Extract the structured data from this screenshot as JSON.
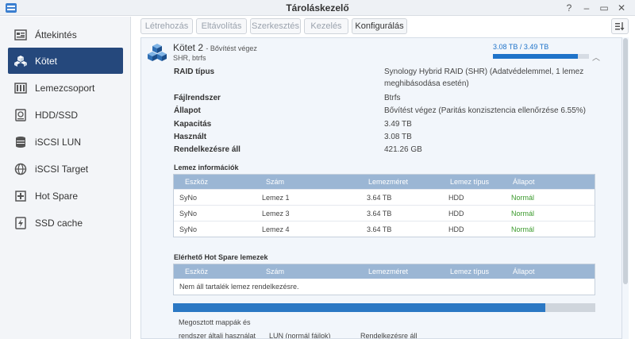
{
  "window": {
    "title": "Tároláskezelő",
    "controls": [
      "?",
      "–",
      "▭",
      "✕"
    ]
  },
  "sidebar": {
    "items": [
      {
        "label": "Áttekintés",
        "icon": "overview-icon",
        "active": false
      },
      {
        "label": "Kötet",
        "icon": "volume-icon",
        "active": true
      },
      {
        "label": "Lemezcsoport",
        "icon": "disk-group-icon",
        "active": false
      },
      {
        "label": "HDD/SSD",
        "icon": "hdd-icon",
        "active": false
      },
      {
        "label": "iSCSI LUN",
        "icon": "iscsi-lun-icon",
        "active": false
      },
      {
        "label": "iSCSI Target",
        "icon": "iscsi-target-icon",
        "active": false
      },
      {
        "label": "Hot Spare",
        "icon": "hot-spare-icon",
        "active": false
      },
      {
        "label": "SSD cache",
        "icon": "ssd-cache-icon",
        "active": false
      }
    ]
  },
  "toolbar": {
    "create": "Létrehozás",
    "remove": "Eltávolítás",
    "edit": "Szerkesztés",
    "manage": "Kezelés",
    "configure": "Konfigurálás"
  },
  "volume": {
    "name": "Kötet 2",
    "state": "Bővítést végez",
    "subtitle": "SHR, btrfs",
    "usage_text": "3.08 TB / 3.49 TB",
    "usage_fraction": 0.882,
    "properties": [
      {
        "label": "RAID típus",
        "value": "Synology Hybrid RAID (SHR) (Adatvédelemmel, 1 lemez meghibásodása esetén)"
      },
      {
        "label": "Fájlrendszer",
        "value": "Btrfs"
      },
      {
        "label": "Állapot",
        "value": "Bővítést végez (Paritás konzisztencia ellenőrzése 6.55%)"
      },
      {
        "label": "Kapacitás",
        "value": "3.49 TB"
      },
      {
        "label": "Használt",
        "value": "3.08 TB"
      },
      {
        "label": "Rendelkezésre áll",
        "value": "421.26 GB"
      }
    ]
  },
  "disk_info": {
    "title": "Lemez információk",
    "columns": [
      "Eszköz",
      "Szám",
      "Lemezméret",
      "Lemez típus",
      "Állapot"
    ],
    "rows": [
      [
        "SyNo",
        "Lemez 1",
        "3.64 TB",
        "HDD",
        "Normál"
      ],
      [
        "SyNo",
        "Lemez 3",
        "3.64 TB",
        "HDD",
        "Normál"
      ],
      [
        "SyNo",
        "Lemez 4",
        "3.64 TB",
        "HDD",
        "Normál"
      ]
    ]
  },
  "hot_spare": {
    "title": "Elérhető Hot Spare lemezek",
    "columns": [
      "Eszköz",
      "Szám",
      "Lemezméret",
      "Lemez típus",
      "Állapot"
    ],
    "empty_text": "Nem áll tartalék lemez rendelkezésre."
  },
  "usage_breakdown": {
    "fill_fraction": 0.882,
    "legend": {
      "shared_line1": "Megosztott mappák és",
      "shared_line2": "rendszer általi használat",
      "lun": "LUN (normál fájlok)",
      "available": "Rendelkezésre áll"
    }
  },
  "colors": {
    "accent": "#1f73c9",
    "sidebar_active": "#25487c",
    "table_header": "#9bb6d4",
    "status_normal": "#3b9a2c"
  }
}
